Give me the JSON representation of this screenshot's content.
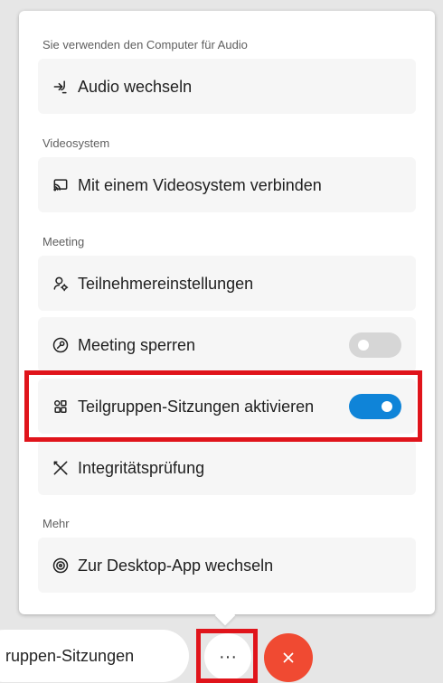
{
  "menu": {
    "sections": [
      {
        "title": "Sie verwenden den Computer für Audio",
        "items": [
          {
            "label": "Audio wechseln",
            "icon": "audio-switch-icon"
          }
        ]
      },
      {
        "title": "Videosystem",
        "items": [
          {
            "label": "Mit einem Videosystem verbinden",
            "icon": "cast-icon"
          }
        ]
      },
      {
        "title": "Meeting",
        "items": [
          {
            "label": "Teilnehmereinstellungen",
            "icon": "participant-settings-icon"
          },
          {
            "label": "Meeting sperren",
            "icon": "lock-icon",
            "toggle": false
          },
          {
            "label": "Teilgruppen-Sitzungen aktivieren",
            "icon": "breakout-icon",
            "toggle": true
          },
          {
            "label": "Integritätsprüfung",
            "icon": "tools-icon"
          }
        ]
      },
      {
        "title": "Mehr",
        "items": [
          {
            "label": "Zur Desktop-App wechseln",
            "icon": "desktop-app-icon"
          }
        ]
      }
    ]
  },
  "footer": {
    "pill_label": "ruppen-Sitzungen",
    "more_label": "···"
  },
  "colors": {
    "toggle_on": "#0f84d8",
    "toggle_off": "#d6d6d6",
    "highlight": "#e0141b",
    "end_call": "#f04a32"
  }
}
